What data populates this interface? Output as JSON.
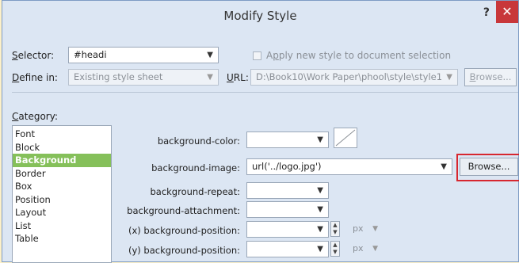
{
  "dialog": {
    "title": "Modify Style",
    "help_label": "?",
    "close_label": "✕"
  },
  "selector": {
    "label_prefix": "",
    "label_underlined": "S",
    "label_rest": "elector:",
    "value": "#headi",
    "apply_label_pre": "A",
    "apply_label_underlined": "p",
    "apply_label_rest": "ply new style to document selection"
  },
  "define_in": {
    "label_underlined": "D",
    "label_rest": "efine in:",
    "value": "Existing style sheet",
    "url_label_underlined": "U",
    "url_label_rest": "RL:",
    "url_value": "D:\\Book10\\Work Paper\\phool\\style\\style1",
    "browse_label_underlined": "B",
    "browse_label_rest": "rowse..."
  },
  "category": {
    "label_underlined": "C",
    "label_rest": "ategory:",
    "items": [
      "Font",
      "Block",
      "Background",
      "Border",
      "Box",
      "Position",
      "Layout",
      "List",
      "Table"
    ],
    "selected": "Background"
  },
  "properties": {
    "background_color": {
      "label": "background-color:",
      "value": ""
    },
    "background_image": {
      "label": "background-image:",
      "value": "url('../logo.jpg')"
    },
    "background_repeat": {
      "label": "background-repeat:",
      "value": ""
    },
    "background_attachment": {
      "label": "background-attachment:",
      "value": ""
    },
    "x_position": {
      "label": "(x) background-position:",
      "value": "",
      "unit": "px"
    },
    "y_position": {
      "label": "(y) background-position:",
      "value": "",
      "unit": "px"
    },
    "browse_label": "Browse..."
  },
  "colors": {
    "accent": "#85c05a",
    "close": "#c8373a",
    "highlight": "#d7272f"
  }
}
